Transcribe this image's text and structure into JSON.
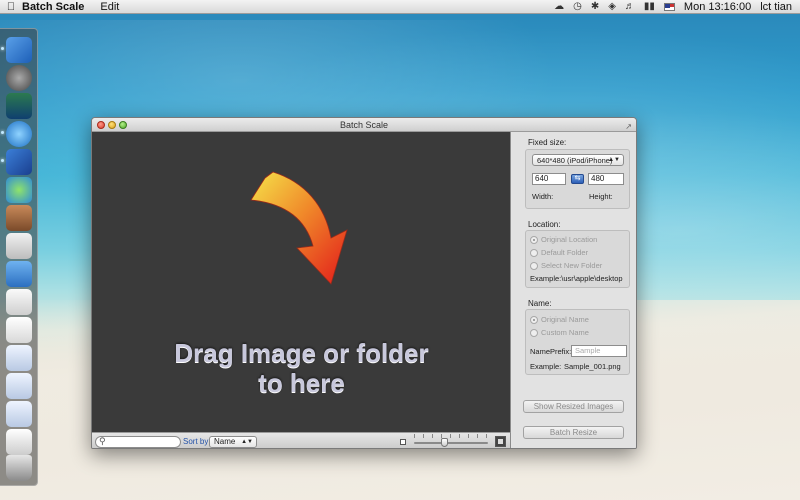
{
  "menubar": {
    "app_name": "Batch Scale",
    "menus": [
      "Edit"
    ],
    "clock": "Mon 13:16:00",
    "user": "lct tian"
  },
  "window": {
    "title": "Batch Scale"
  },
  "droparea": {
    "line1": "Drag Image or folder",
    "line2": "to here"
  },
  "bottombar": {
    "search_placeholder": "",
    "sort_label": "Sort by",
    "sort_value": "Name"
  },
  "panel": {
    "fixed_size": {
      "title": "Fixed size:",
      "preset": "640*480 (iPod/iPhone)",
      "width_value": "640",
      "height_value": "480",
      "width_label": "Width:",
      "height_label": "Height:"
    },
    "location": {
      "title": "Location:",
      "options": [
        "Original Location",
        "Default Folder",
        "Select New Folder"
      ],
      "example": "Example:\\usr\\apple\\desktop"
    },
    "name": {
      "title": "Name:",
      "options": [
        "Original Name",
        "Custom Name"
      ],
      "prefix_label": "NamePrefix:",
      "prefix_placeholder": "Sample",
      "example_label": "Example:",
      "example_value": "Sample_001.png"
    },
    "show_resized_label": "Show Resized Images",
    "batch_resize_label": "Batch Resize"
  }
}
